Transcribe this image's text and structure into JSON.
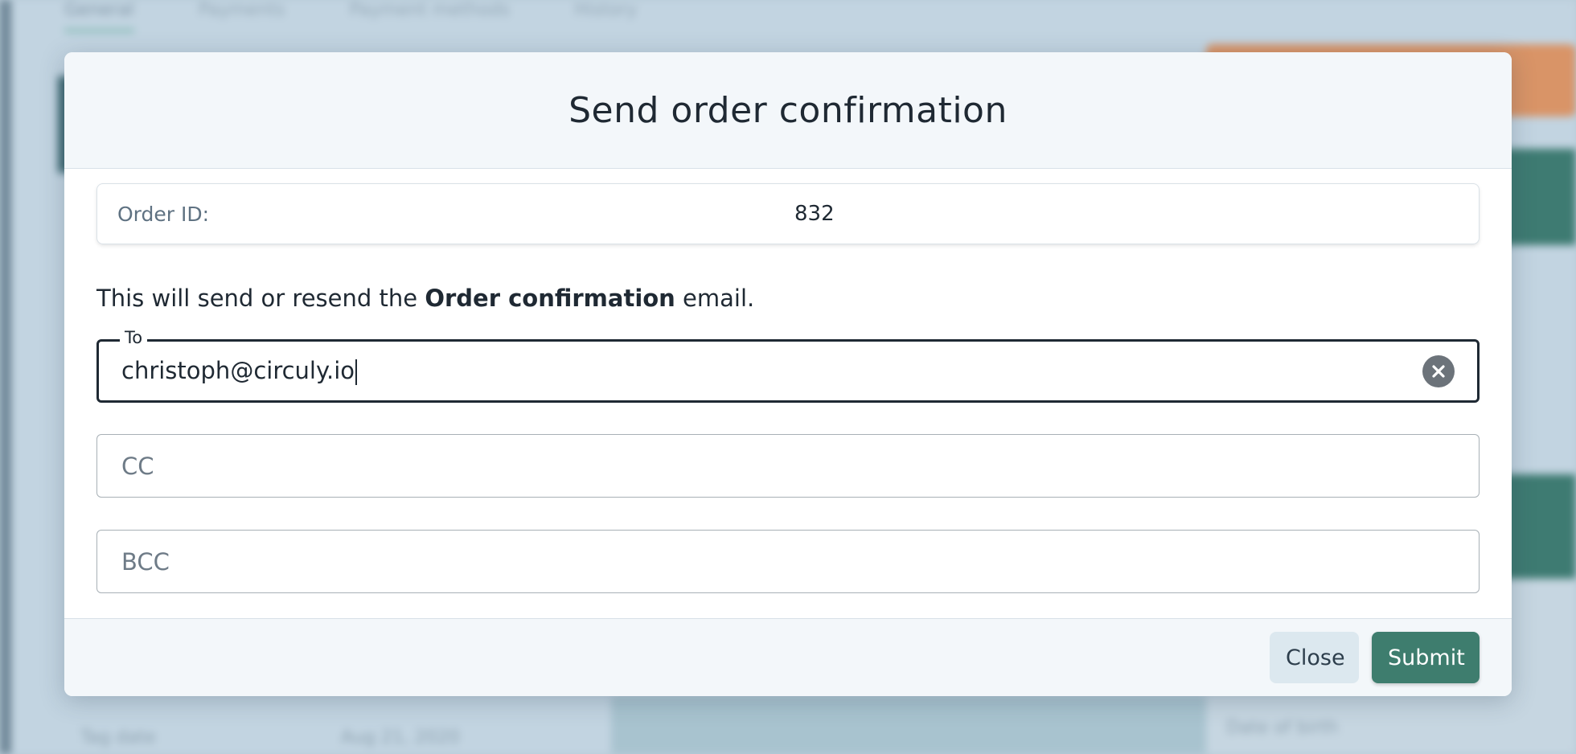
{
  "background": {
    "tabs": [
      "General",
      "Payments",
      "Payment methods",
      "History"
    ],
    "bottom_left_label": "Tag date",
    "bottom_left_value": "Aug 21, 2020",
    "right_label": "Date of birth"
  },
  "modal": {
    "title": "Send order confirmation",
    "order": {
      "label": "Order ID:",
      "value": "832"
    },
    "info": {
      "prefix": "This will send or resend the ",
      "bold": "Order confirmation",
      "suffix": " email."
    },
    "to": {
      "legend": "To",
      "value": "christoph@circuly.io"
    },
    "cc": {
      "placeholder": "CC"
    },
    "bcc": {
      "placeholder": "BCC"
    },
    "buttons": {
      "close": "Close",
      "submit": "Submit"
    }
  },
  "colors": {
    "submit": "#3e7d6e",
    "close_bg": "#dce8ef"
  }
}
